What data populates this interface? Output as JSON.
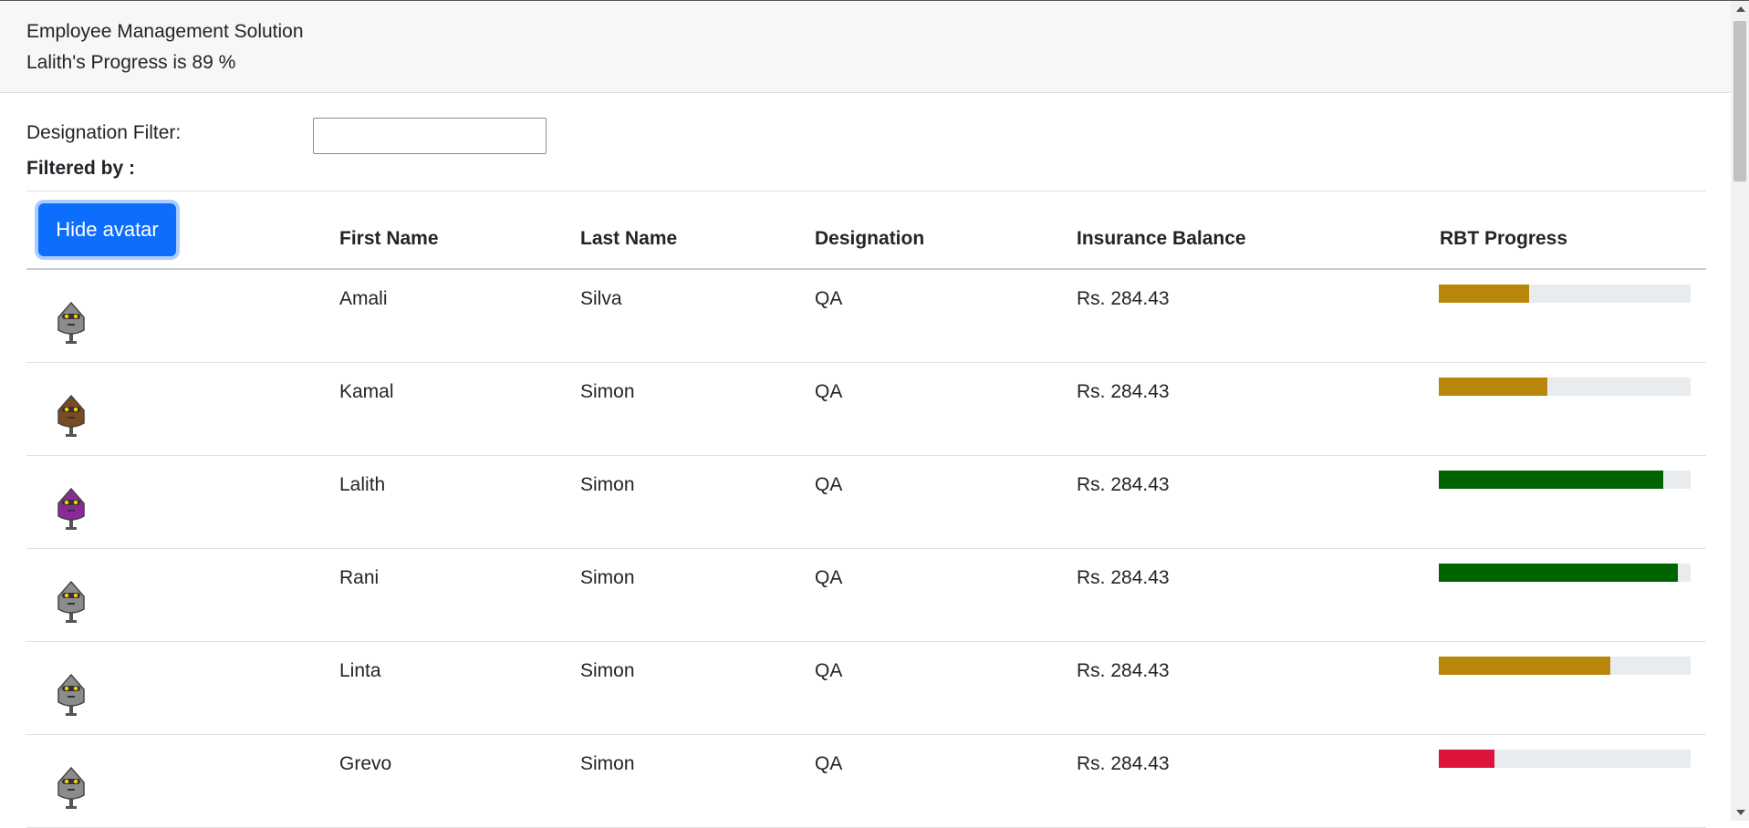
{
  "header": {
    "title": "Employee Management Solution",
    "progress_text": "Lalith's Progress is 89 %"
  },
  "filter": {
    "label": "Designation Filter:",
    "value": "",
    "filtered_by_label": "Filtered by :"
  },
  "toggle_avatar_label": "Hide avatar",
  "table": {
    "columns": [
      "First Name",
      "Last Name",
      "Designation",
      "Insurance Balance",
      "RBT Progress"
    ],
    "rows": [
      {
        "first": "Amali",
        "last": "Silva",
        "designation": "QA",
        "insurance": "Rs. 284.43",
        "progress": 36,
        "bar_color": "#b8860b",
        "avatar": "gray-robot-avatar",
        "avatar_color": "#8c8c8c"
      },
      {
        "first": "Kamal",
        "last": "Simon",
        "designation": "QA",
        "insurance": "Rs. 284.43",
        "progress": 43,
        "bar_color": "#b8860b",
        "avatar": "brown-robot-avatar",
        "avatar_color": "#7a4a22"
      },
      {
        "first": "Lalith",
        "last": "Simon",
        "designation": "QA",
        "insurance": "Rs. 284.43",
        "progress": 89,
        "bar_color": "#006400",
        "avatar": "purple-robot-avatar",
        "avatar_color": "#8a2a9a"
      },
      {
        "first": "Rani",
        "last": "Simon",
        "designation": "QA",
        "insurance": "Rs. 284.43",
        "progress": 95,
        "bar_color": "#006400",
        "avatar": "gray-robot-avatar",
        "avatar_color": "#8c8c8c"
      },
      {
        "first": "Linta",
        "last": "Simon",
        "designation": "QA",
        "insurance": "Rs. 284.43",
        "progress": 68,
        "bar_color": "#b8860b",
        "avatar": "gray-robot-avatar",
        "avatar_color": "#8c8c8c"
      },
      {
        "first": "Grevo",
        "last": "Simon",
        "designation": "QA",
        "insurance": "Rs. 284.43",
        "progress": 22,
        "bar_color": "#dc143c",
        "avatar": "gray-robot-avatar",
        "avatar_color": "#8c8c8c"
      }
    ]
  }
}
